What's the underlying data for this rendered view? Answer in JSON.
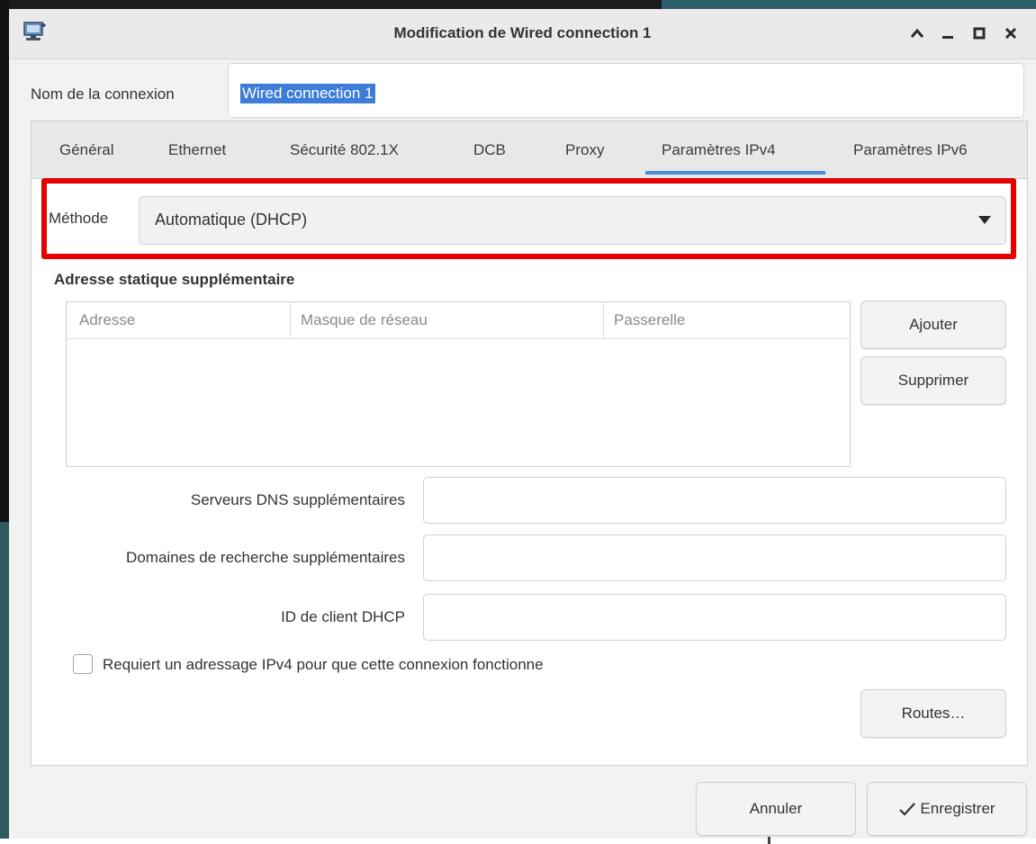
{
  "window": {
    "title": "Modification de Wired connection 1",
    "controls": {
      "up": "^",
      "minimize": "_",
      "maximize": "□",
      "close": "✕"
    }
  },
  "connection_name": {
    "label": "Nom de la connexion",
    "value": "Wired connection 1"
  },
  "tabs": [
    {
      "label": "Général"
    },
    {
      "label": "Ethernet"
    },
    {
      "label": "Sécurité 802.1X"
    },
    {
      "label": "DCB"
    },
    {
      "label": "Proxy"
    },
    {
      "label": "Paramètres IPv4",
      "active": true
    },
    {
      "label": "Paramètres IPv6"
    }
  ],
  "ipv4": {
    "method_label": "Méthode",
    "method_value": "Automatique (DHCP)",
    "static_section_title": "Adresse statique supplémentaire",
    "table_headers": [
      "Adresse",
      "Masque de réseau",
      "Passerelle"
    ],
    "add_button": "Ajouter",
    "delete_button": "Supprimer",
    "dns_label": "Serveurs DNS supplémentaires",
    "dns_value": "",
    "search_domains_label": "Domaines de recherche supplémentaires",
    "search_domains_value": "",
    "dhcp_client_id_label": "ID de client DHCP",
    "dhcp_client_id_value": "",
    "require_ipv4_label": "Requiert un adressage IPv4 pour que cette connexion fonctionne",
    "require_ipv4_checked": false,
    "routes_button": "Routes…"
  },
  "footer": {
    "cancel_button": "Annuler",
    "save_button": "Enregistrer",
    "save_icon": "check-icon"
  },
  "colors": {
    "highlight": "#e60000",
    "selection": "#3d7dd8",
    "active_tab_underline": "#4a90d9"
  }
}
